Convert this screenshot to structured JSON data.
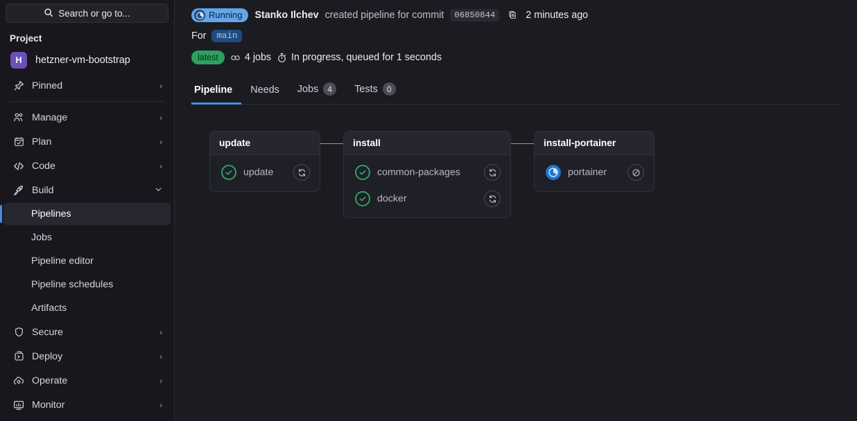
{
  "sidebar": {
    "search": {
      "placeholder": "Search or go to...",
      "icon": "search-icon"
    },
    "section_label": "Project",
    "project": {
      "initial": "H",
      "name": "hetzner-vm-bootstrap",
      "avatar_color": "#6b4fbb"
    },
    "items": [
      {
        "label": "Pinned",
        "icon": "pin-icon",
        "expandable": true,
        "state": "collapsed"
      },
      {
        "label": "Manage",
        "icon": "users-icon",
        "expandable": true,
        "state": "collapsed"
      },
      {
        "label": "Plan",
        "icon": "calendar-icon",
        "expandable": true,
        "state": "collapsed"
      },
      {
        "label": "Code",
        "icon": "code-icon",
        "expandable": true,
        "state": "collapsed"
      },
      {
        "label": "Build",
        "icon": "rocket-icon",
        "expandable": true,
        "state": "expanded"
      }
    ],
    "build_children": [
      {
        "label": "Pipelines",
        "active": true
      },
      {
        "label": "Jobs",
        "active": false
      },
      {
        "label": "Pipeline editor",
        "active": false
      },
      {
        "label": "Pipeline schedules",
        "active": false
      },
      {
        "label": "Artifacts",
        "active": false
      }
    ],
    "items_bottom": [
      {
        "label": "Secure",
        "icon": "shield-icon",
        "expandable": true
      },
      {
        "label": "Deploy",
        "icon": "deploy-icon",
        "expandable": true
      },
      {
        "label": "Operate",
        "icon": "operate-icon",
        "expandable": true
      },
      {
        "label": "Monitor",
        "icon": "monitor-icon",
        "expandable": true
      }
    ],
    "chevron_right": "›",
    "chevron_down": "⌄"
  },
  "header": {
    "status_badge": {
      "label": "Running",
      "color": "#63a6e9",
      "icon": "running-pie-icon"
    },
    "author": "Stanko Ilchev",
    "action_text": "created pipeline for commit",
    "commit_sha": "06850844",
    "copy_icon": "clipboard-copy-icon",
    "time_ago": "2 minutes ago",
    "for_label": "For",
    "ref_name": "main",
    "ref_color": "#1f4c80",
    "latest_badge": {
      "label": "latest",
      "color": "#2da160"
    },
    "jobs_count_label": "4 jobs",
    "jobs_icon": "link-icon",
    "duration_icon": "stopwatch-icon",
    "duration_text": "In progress, queued for 1 seconds"
  },
  "tabs": [
    {
      "label": "Pipeline",
      "count": null,
      "active": true
    },
    {
      "label": "Needs",
      "count": null,
      "active": false
    },
    {
      "label": "Jobs",
      "count": "4",
      "active": false
    },
    {
      "label": "Tests",
      "count": "0",
      "active": false
    }
  ],
  "pipeline": {
    "stages": [
      {
        "name": "update",
        "width": "narrow",
        "jobs": [
          {
            "name": "update",
            "status": "success",
            "status_icon": "check-circle-icon",
            "action": "retry",
            "action_icon": "retry-icon"
          }
        ]
      },
      {
        "name": "install",
        "width": "wide",
        "jobs": [
          {
            "name": "common-packages",
            "status": "success",
            "status_icon": "check-circle-icon",
            "action": "retry",
            "action_icon": "retry-icon"
          },
          {
            "name": "docker",
            "status": "success",
            "status_icon": "check-circle-icon",
            "action": "retry",
            "action_icon": "retry-icon"
          }
        ]
      },
      {
        "name": "install-portainer",
        "width": "mid",
        "jobs": [
          {
            "name": "portainer",
            "status": "running",
            "status_icon": "running-pie-icon",
            "action": "cancel",
            "action_icon": "cancel-icon"
          }
        ]
      }
    ]
  },
  "colors": {
    "accent": "#428fdc",
    "success": "#2da160",
    "running": "#1f75cf",
    "sidebar_bg": "#18171d",
    "main_bg": "#1b1c22"
  }
}
